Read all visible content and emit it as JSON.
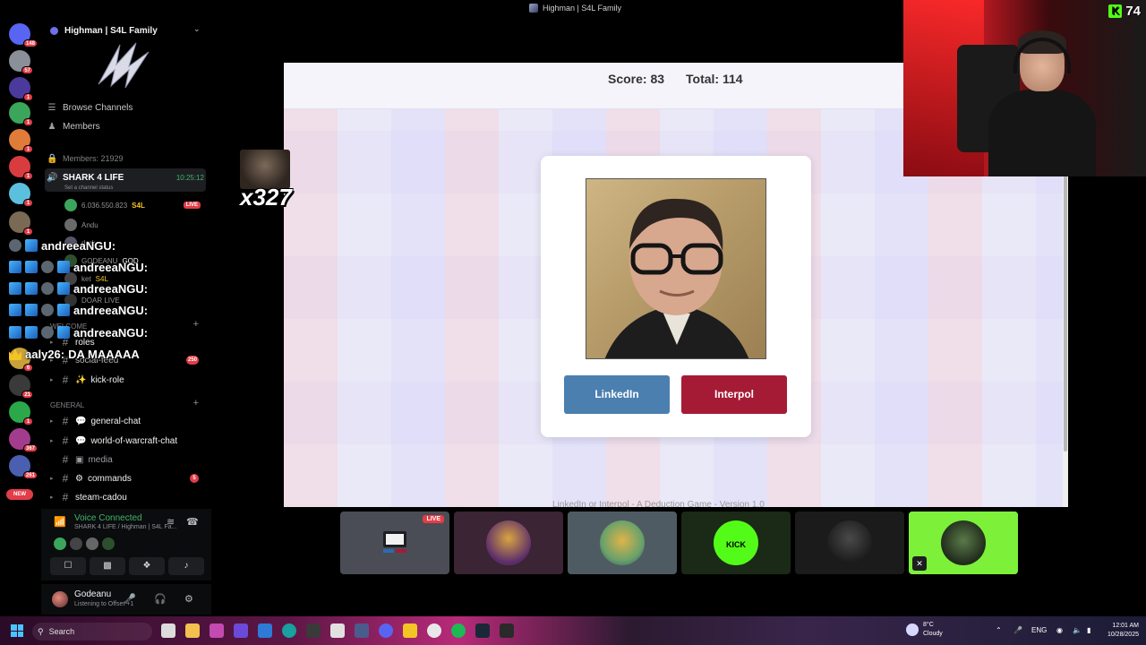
{
  "window": {
    "title": "Highman | S4L Family"
  },
  "rail": {
    "servers": [
      {
        "icon": "discord-home-icon",
        "color": "#5865f2",
        "badge": "148"
      },
      {
        "icon": "server-icon",
        "color": "#8a8f98",
        "badge": "57"
      },
      {
        "icon": "server-icon",
        "color": "#4b3a9c",
        "badge": "1"
      },
      {
        "icon": "server-icon",
        "color": "#3ba55c",
        "badge": "1"
      },
      {
        "icon": "server-icon",
        "color": "#e07b39",
        "badge": "1"
      },
      {
        "icon": "server-icon",
        "color": "#d83c3e",
        "badge": "1"
      },
      {
        "icon": "server-icon",
        "color": "#5bc0de",
        "badge": "1"
      },
      {
        "icon": "server-icon",
        "color": "#7a6a55",
        "badge": "1"
      },
      {
        "icon": "server-icon",
        "color": "#c8a13a",
        "badge": "6"
      },
      {
        "icon": "server-icon",
        "color": "#3a3a3a",
        "badge": "21"
      },
      {
        "icon": "server-icon",
        "color": "#2aa84a",
        "badge": "1"
      },
      {
        "icon": "server-icon",
        "color": "#a33c8c",
        "badge": "367"
      },
      {
        "icon": "server-icon",
        "color": "#4a5fb0",
        "badge": "261"
      }
    ],
    "new_label": "NEW"
  },
  "sidebar": {
    "server_name": "Highman | S4L Family",
    "browse_channels": "Browse Channels",
    "members": "Members",
    "members_count": "Members: 21929",
    "active_channel": {
      "name": "SHARK 4 LIFE",
      "time": "10:25:12",
      "status_hint": "Set a channel status"
    },
    "voice_users": [
      {
        "name": "6.036.550.823",
        "tag": "S4L",
        "live": "LIVE"
      },
      {
        "name": "Andu"
      },
      {
        "name": "dark"
      },
      {
        "name": "GODEANU",
        "tag": "GOD"
      },
      {
        "name": "ket",
        "tag": "S4L"
      },
      {
        "name": "DOAR LIVE"
      }
    ],
    "welcome_category": "WELCOME",
    "welcome_channels": [
      {
        "name": "roles"
      },
      {
        "name": "social-feed",
        "badge": "250"
      },
      {
        "name": "kick-role"
      }
    ],
    "general_category": "GENERAL",
    "general_channels": [
      {
        "name": "general-chat"
      },
      {
        "name": "world-of-warcraft-chat"
      },
      {
        "name": "media"
      },
      {
        "name": "commands",
        "badge": "5"
      },
      {
        "name": "steam-cadou"
      }
    ]
  },
  "chat_overlay": [
    {
      "user": "andreeaNGU:",
      "text": ""
    },
    {
      "user": "andreeaNGU:",
      "text": ""
    },
    {
      "user": "andreeaNGU:",
      "text": ""
    },
    {
      "user": "andreeaNGU:",
      "text": ""
    },
    {
      "user": "andreeaNGU:",
      "text": ""
    },
    {
      "user": "aaly26:",
      "text": "DA MAAAAA"
    }
  ],
  "voice_panel": {
    "title": "Voice Connected",
    "subtitle": "SHARK 4 LIFE / Highman | S4L Fa..."
  },
  "user_panel": {
    "name": "Godeanu",
    "status": "Listening to Offset +1"
  },
  "game": {
    "score_label": "Score: 83",
    "total_label": "Total: 114",
    "btn_linkedin": "LinkedIn",
    "btn_interpol": "Interpol",
    "footer": "LinkedIn or Interpol - A Deduction Game - Version 1.0"
  },
  "emote": {
    "multiplier": "x327"
  },
  "webcam": {
    "viewer_count": "74"
  },
  "tiles": [
    {
      "type": "screen",
      "live": "LIVE",
      "bg": "#4a4d55"
    },
    {
      "type": "avatar",
      "bg": "#3b2433"
    },
    {
      "type": "avatar",
      "bg": "#4f5b63"
    },
    {
      "type": "avatar",
      "bg": "#1a2a16",
      "label": "KICK"
    },
    {
      "type": "avatar",
      "bg": "#1b1b1b"
    },
    {
      "type": "avatar",
      "bg": "#7df03a"
    }
  ],
  "taskbar": {
    "search_placeholder": "Search",
    "temperature": "8°C",
    "weather": "Cloudy",
    "lang": "ENG",
    "time": "12:01 AM",
    "date": "10/28/2025"
  }
}
